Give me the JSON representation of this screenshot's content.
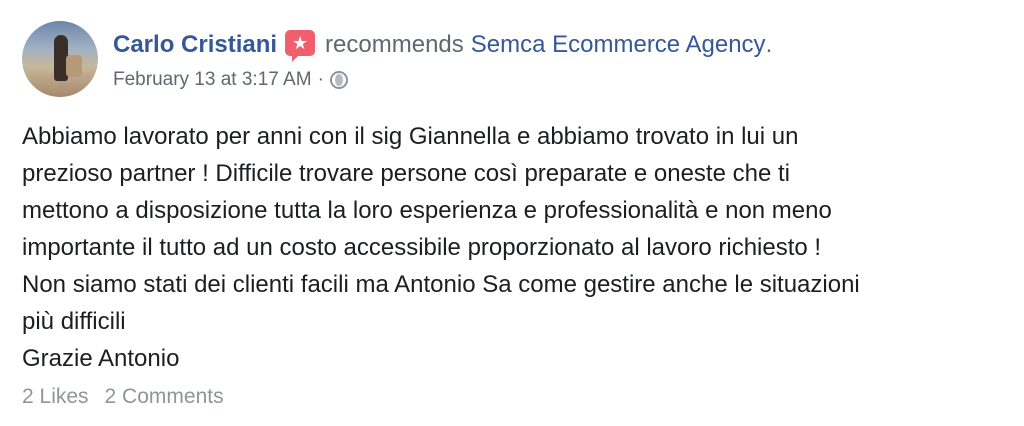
{
  "post": {
    "author": "Carlo Cristiani",
    "verb": "recommends",
    "page": "Semca Ecommerce Agency",
    "page_suffix": ".",
    "timestamp": "February 13 at 3:17 AM",
    "separator": "·",
    "privacy_icon": "globe-icon",
    "recommend_icon": "recommendation-star-icon",
    "body_lines": [
      "Abbiamo lavorato per anni con il sig Giannella e abbiamo trovato in lui un",
      "prezioso partner ! Difficile trovare persone così preparate e oneste che ti",
      "mettono a disposizione tutta la loro esperienza e professionalità e non meno",
      "importante il tutto ad un costo accessibile proporzionato al lavoro richiesto !",
      "Non siamo stati dei clienti facili ma Antonio Sa come gestire anche le situazioni",
      "più difficili",
      "Grazie Antonio"
    ],
    "likes": "2 Likes",
    "comments": "2 Comments"
  },
  "colors": {
    "link": "#365899",
    "secondary_text": "#606770",
    "footer_text": "#90949c",
    "recommend_badge": "#f05f6e"
  }
}
